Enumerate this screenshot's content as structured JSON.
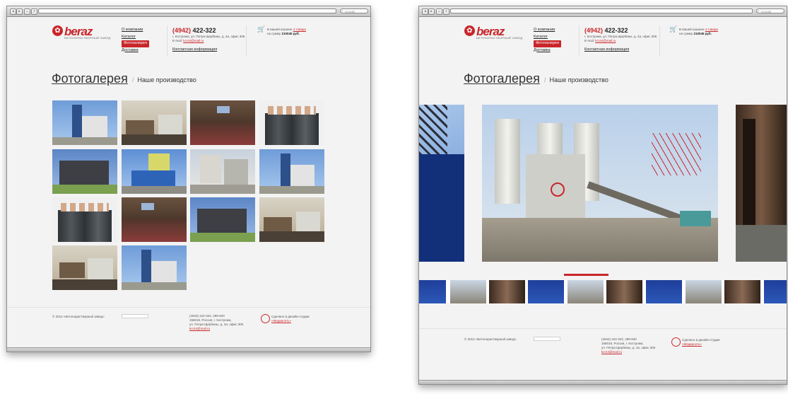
{
  "browser": {
    "nav_back": "◂",
    "nav_forward": "▸",
    "nav_home": "⌂",
    "nav_add": "+",
    "search_placeholder": "Google"
  },
  "site": {
    "logo_mark": "✿",
    "logo_word": "beraz",
    "logo_tagline": "БЕТОНОРАСТВОРНЫЙ ЗАВОД",
    "menu": [
      {
        "label": "О компании",
        "active": false
      },
      {
        "label": "Каталог",
        "active": false
      },
      {
        "label": "Фотогалерея",
        "active": true
      },
      {
        "label": "Доставка",
        "active": false
      }
    ],
    "phone_code": "(4942)",
    "phone_number": "422-322",
    "address_line": "г. Кострома, ул. Петра Щербины, д. 4а, офис 306",
    "email_label": "E-mail:",
    "email": "kcr44@mail.ru",
    "contact_link": "Контактная информация",
    "cart_line1_prefix": "В вашей корзине",
    "cart_line1_link": "4 товара",
    "cart_line2_prefix": "на сумму",
    "cart_sum": "210045 руб."
  },
  "gallery": {
    "title": "Фотогалерея",
    "separator": "/",
    "crumb": "Наше производство"
  },
  "footer": {
    "copyright": "© 2012 «Бетонорастворный завод»",
    "phones": "(4942) 422-322, 499-940",
    "address1": "156019, Россия, г. Кострома,",
    "address2": "ул. Петра Щербины, д. 4а, офис 306",
    "email": "kcr44@mail.ru",
    "studio_line": "Сделано в дизайн-студии",
    "studio_name": "«Медиасеть»"
  },
  "colors": {
    "accent": "#c9262a",
    "page_bg": "#f3f3f3"
  },
  "icons": {
    "cart": "cart-icon",
    "studio": "studio-logo-icon",
    "search": "search-icon"
  }
}
